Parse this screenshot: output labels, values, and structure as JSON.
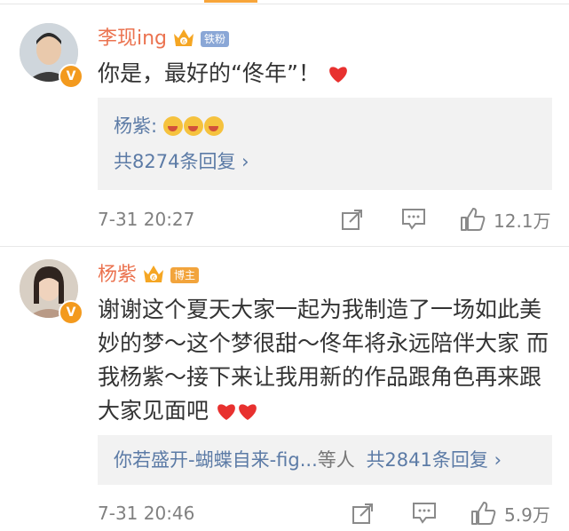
{
  "comments": [
    {
      "author": "李现ing",
      "tag": "铁粉",
      "text": "你是，最好的“佟年”！",
      "reply": {
        "author": "杨紫:",
        "count_label": "共8274条回复"
      },
      "time": "7-31 20:27",
      "likes": "12.1万",
      "icons": [
        "avatar",
        "verified-badge-icon",
        "crown-badge-icon",
        "heart-icon",
        "grin-emoji-icon",
        "repost-icon",
        "comment-icon",
        "like-icon",
        "chevron-right-icon"
      ]
    },
    {
      "author": "杨紫",
      "tag": "博主",
      "text": "谢谢这个夏天大家一起为我制造了一场如此美妙的梦～这个梦很甜～佟年将永远陪伴大家 而我杨紫～接下来让我用新的作品跟角色再来跟大家见面吧",
      "reply": {
        "author": "你若盛开-蝴蝶自来-fig...",
        "others": "等人",
        "count_label": "共2841条回复"
      },
      "time": "7-31 20:46",
      "likes": "5.9万"
    }
  ],
  "colors": {
    "name": "#eb7350",
    "link": "#5c7ba6",
    "heart": "#e8312f",
    "badge": "#f39a1e",
    "fan_tag": "#8aa7d6",
    "host_tag": "#f2a43c"
  }
}
